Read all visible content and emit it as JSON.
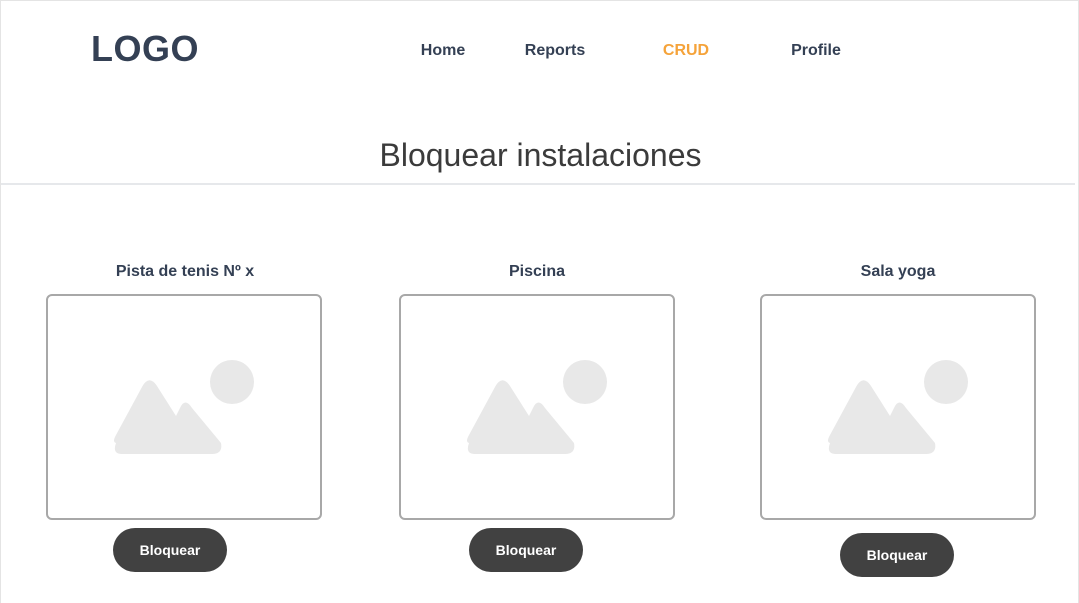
{
  "header": {
    "logo": "LOGO",
    "nav": [
      {
        "label": "Home",
        "active": false
      },
      {
        "label": "Reports",
        "active": false
      },
      {
        "label": "CRUD",
        "active": true
      },
      {
        "label": "Profile",
        "active": false
      }
    ],
    "active_color": "#f5a33a"
  },
  "main": {
    "title": "Bloquear instalaciones",
    "cards": [
      {
        "title": "Pista de tenis Nº x",
        "image_icon": "image-placeholder-icon",
        "button_label": "Bloquear"
      },
      {
        "title": "Piscina",
        "image_icon": "image-placeholder-icon",
        "button_label": "Bloquear"
      },
      {
        "title": "Sala yoga",
        "image_icon": "image-placeholder-icon",
        "button_label": "Bloquear"
      }
    ]
  }
}
